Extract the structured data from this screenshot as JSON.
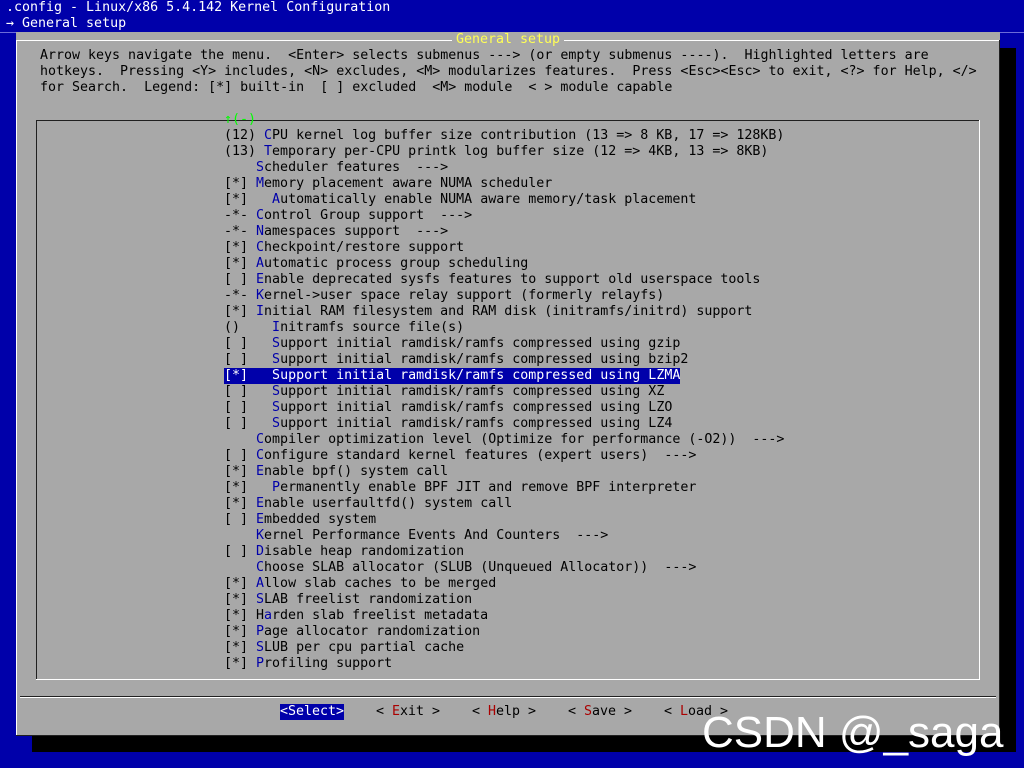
{
  "window": {
    "title": ".config - Linux/x86 5.4.142 Kernel Configuration",
    "breadcrumb": "→ General setup"
  },
  "dialog": {
    "title": "General setup",
    "help_lines": [
      "Arrow keys navigate the menu.  <Enter> selects submenus ---> (or empty submenus ----).  Highlighted letters are",
      "hotkeys.  Pressing <Y> includes, <N> excludes, <M> modularizes features.  Press <Esc><Esc> to exit, <?> for Help, </>",
      "for Search.  Legend: [*] built-in  [ ] excluded  <M> module  < > module capable"
    ],
    "scroll_indicator": "↑(-)"
  },
  "menu": {
    "items": [
      {
        "prefix": "(12) ",
        "hotkey": "C",
        "rest": "PU kernel log buffer size contribution (13 => 8 KB, 17 => 128KB)"
      },
      {
        "prefix": "(13) ",
        "hotkey": "T",
        "rest": "emporary per-CPU printk log buffer size (12 => 4KB, 13 => 8KB)"
      },
      {
        "prefix": "    ",
        "hotkey": "S",
        "rest": "cheduler features  --->"
      },
      {
        "prefix": "[*] ",
        "hotkey": "M",
        "rest": "emory placement aware NUMA scheduler"
      },
      {
        "prefix": "[*]   ",
        "hotkey": "A",
        "rest": "utomatically enable NUMA aware memory/task placement"
      },
      {
        "prefix": "-*- ",
        "hotkey": "C",
        "rest": "ontrol Group support  --->"
      },
      {
        "prefix": "-*- ",
        "hotkey": "N",
        "rest": "amespaces support  --->"
      },
      {
        "prefix": "[*] ",
        "hotkey": "C",
        "rest": "heckpoint/restore support"
      },
      {
        "prefix": "[*] ",
        "hotkey": "A",
        "rest": "utomatic process group scheduling"
      },
      {
        "prefix": "[ ] ",
        "hotkey": "E",
        "rest": "nable deprecated sysfs features to support old userspace tools"
      },
      {
        "prefix": "-*- ",
        "hotkey": "K",
        "rest": "ernel->user space relay support (formerly relayfs)"
      },
      {
        "prefix": "[*] ",
        "hotkey": "I",
        "rest": "nitial RAM filesystem and RAM disk (initramfs/initrd) support"
      },
      {
        "prefix": "()    ",
        "hotkey": "I",
        "rest": "nitramfs source file(s)"
      },
      {
        "prefix": "[ ]   ",
        "hotkey": "S",
        "rest": "upport initial ramdisk/ramfs compressed using gzip"
      },
      {
        "prefix": "[ ]   ",
        "hotkey": "S",
        "rest": "upport initial ramdisk/ramfs compressed using bzip2"
      },
      {
        "prefix": "[*]   ",
        "hotkey": "S",
        "rest": "upport initial ramdisk/ramfs compressed using LZMA",
        "selected": true
      },
      {
        "prefix": "[ ]   ",
        "hotkey": "S",
        "rest": "upport initial ramdisk/ramfs compressed using XZ"
      },
      {
        "prefix": "[ ]   ",
        "hotkey": "S",
        "rest": "upport initial ramdisk/ramfs compressed using LZO"
      },
      {
        "prefix": "[ ]   ",
        "hotkey": "S",
        "rest": "upport initial ramdisk/ramfs compressed using LZ4"
      },
      {
        "prefix": "    ",
        "hotkey": "C",
        "rest": "ompiler optimization level (Optimize for performance (-O2))  --->"
      },
      {
        "prefix": "[ ] ",
        "hotkey": "C",
        "rest": "onfigure standard kernel features (expert users)  --->"
      },
      {
        "prefix": "[*] ",
        "hotkey": "E",
        "rest": "nable bpf() system call"
      },
      {
        "prefix": "[*]   ",
        "hotkey": "P",
        "rest": "ermanently enable BPF JIT and remove BPF interpreter"
      },
      {
        "prefix": "[*] ",
        "hotkey": "E",
        "rest": "nable userfaultfd() system call"
      },
      {
        "prefix": "[ ] ",
        "hotkey": "E",
        "rest": "mbedded system"
      },
      {
        "prefix": "    ",
        "hotkey": "K",
        "rest": "ernel Performance Events And Counters  --->"
      },
      {
        "prefix": "[ ] ",
        "hotkey": "D",
        "rest": "isable heap randomization"
      },
      {
        "prefix": "    ",
        "hotkey": "C",
        "rest": "hoose SLAB allocator (SLUB (Unqueued Allocator))  --->"
      },
      {
        "prefix": "[*] ",
        "hotkey": "A",
        "rest": "llow slab caches to be merged"
      },
      {
        "prefix": "[*] ",
        "hotkey": "S",
        "rest": "LAB freelist randomization"
      },
      {
        "prefix": "[*] H",
        "hotkey": "a",
        "rest": "rden slab freelist metadata"
      },
      {
        "prefix": "[*] ",
        "hotkey": "P",
        "rest": "age allocator randomization"
      },
      {
        "prefix": "[*] ",
        "hotkey": "S",
        "rest": "LUB per cpu partial cache"
      },
      {
        "prefix": "[*] ",
        "hotkey": "P",
        "rest": "rofiling support"
      }
    ]
  },
  "buttons": [
    {
      "pre": "<",
      "hotkey": "S",
      "rest": "elect>",
      "selected": true,
      "name": "select-button"
    },
    {
      "pre": "< ",
      "hotkey": "E",
      "rest": "xit >",
      "name": "exit-button"
    },
    {
      "pre": "< ",
      "hotkey": "H",
      "rest": "elp >",
      "name": "help-button"
    },
    {
      "pre": "< ",
      "hotkey": "S",
      "rest": "ave >",
      "name": "save-button"
    },
    {
      "pre": "< ",
      "hotkey": "L",
      "rest": "oad >",
      "name": "load-button"
    }
  ],
  "watermark": "CSDN @_saga",
  "colors": {
    "background": "#0000aa",
    "dialog": "#a8a8a8",
    "title": "#ffff55",
    "hotkey_menu": "#0000aa",
    "hotkey_button": "#aa0000",
    "selection": "#0000aa"
  }
}
